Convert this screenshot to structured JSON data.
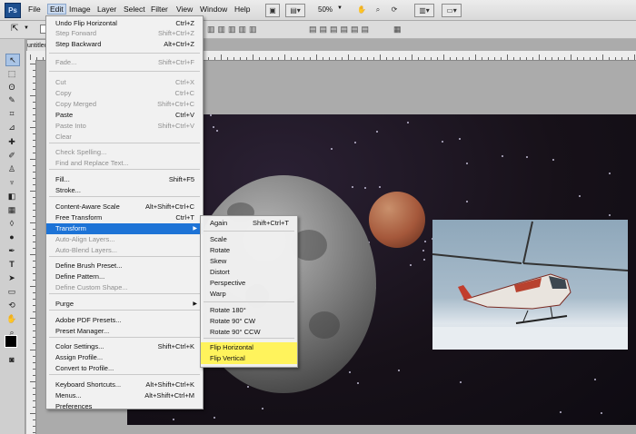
{
  "app": {
    "logo": "Ps"
  },
  "menubar": {
    "items": [
      "File",
      "Edit",
      "Image",
      "Layer",
      "Select",
      "Filter",
      "View",
      "Window",
      "Help"
    ],
    "zoom": "50%"
  },
  "document": {
    "tab_label": "untitled"
  },
  "edit_menu": {
    "items": [
      {
        "label": "Undo Flip Horizontal",
        "shortcut": "Ctrl+Z"
      },
      {
        "label": "Step Forward",
        "shortcut": "Shift+Ctrl+Z"
      },
      {
        "label": "Step Backward",
        "shortcut": "Alt+Ctrl+Z"
      },
      {
        "label": "Fade...",
        "shortcut": "Shift+Ctrl+F"
      },
      {
        "label": "Cut",
        "shortcut": "Ctrl+X"
      },
      {
        "label": "Copy",
        "shortcut": "Ctrl+C"
      },
      {
        "label": "Copy Merged",
        "shortcut": "Shift+Ctrl+C"
      },
      {
        "label": "Paste",
        "shortcut": "Ctrl+V"
      },
      {
        "label": "Paste Into",
        "shortcut": "Shift+Ctrl+V"
      },
      {
        "label": "Clear",
        "shortcut": ""
      },
      {
        "label": "Check Spelling...",
        "shortcut": ""
      },
      {
        "label": "Find and Replace Text...",
        "shortcut": ""
      },
      {
        "label": "Fill...",
        "shortcut": "Shift+F5"
      },
      {
        "label": "Stroke...",
        "shortcut": ""
      },
      {
        "label": "Content-Aware Scale",
        "shortcut": "Alt+Shift+Ctrl+C"
      },
      {
        "label": "Free Transform",
        "shortcut": "Ctrl+T"
      },
      {
        "label": "Transform",
        "shortcut": ""
      },
      {
        "label": "Auto-Align Layers...",
        "shortcut": ""
      },
      {
        "label": "Auto-Blend Layers...",
        "shortcut": ""
      },
      {
        "label": "Define Brush Preset...",
        "shortcut": ""
      },
      {
        "label": "Define Pattern...",
        "shortcut": ""
      },
      {
        "label": "Define Custom Shape...",
        "shortcut": ""
      },
      {
        "label": "Purge",
        "shortcut": ""
      },
      {
        "label": "Adobe PDF Presets...",
        "shortcut": ""
      },
      {
        "label": "Preset Manager...",
        "shortcut": ""
      },
      {
        "label": "Color Settings...",
        "shortcut": "Shift+Ctrl+K"
      },
      {
        "label": "Assign Profile...",
        "shortcut": ""
      },
      {
        "label": "Convert to Profile...",
        "shortcut": ""
      },
      {
        "label": "Keyboard Shortcuts...",
        "shortcut": "Alt+Shift+Ctrl+K"
      },
      {
        "label": "Menus...",
        "shortcut": "Alt+Shift+Ctrl+M"
      },
      {
        "label": "Preferences",
        "shortcut": ""
      }
    ]
  },
  "transform_menu": {
    "items": [
      {
        "label": "Again",
        "shortcut": "Shift+Ctrl+T"
      },
      {
        "label": "Scale",
        "shortcut": ""
      },
      {
        "label": "Rotate",
        "shortcut": ""
      },
      {
        "label": "Skew",
        "shortcut": ""
      },
      {
        "label": "Distort",
        "shortcut": ""
      },
      {
        "label": "Perspective",
        "shortcut": ""
      },
      {
        "label": "Warp",
        "shortcut": ""
      },
      {
        "label": "Rotate 180°",
        "shortcut": ""
      },
      {
        "label": "Rotate 90° CW",
        "shortcut": ""
      },
      {
        "label": "Rotate 90° CCW",
        "shortcut": ""
      },
      {
        "label": "Flip Horizontal",
        "shortcut": ""
      },
      {
        "label": "Flip Vertical",
        "shortcut": ""
      }
    ]
  },
  "colors": {
    "highlight": "#1d73d6",
    "yellow_highlight": "#fff35c"
  }
}
